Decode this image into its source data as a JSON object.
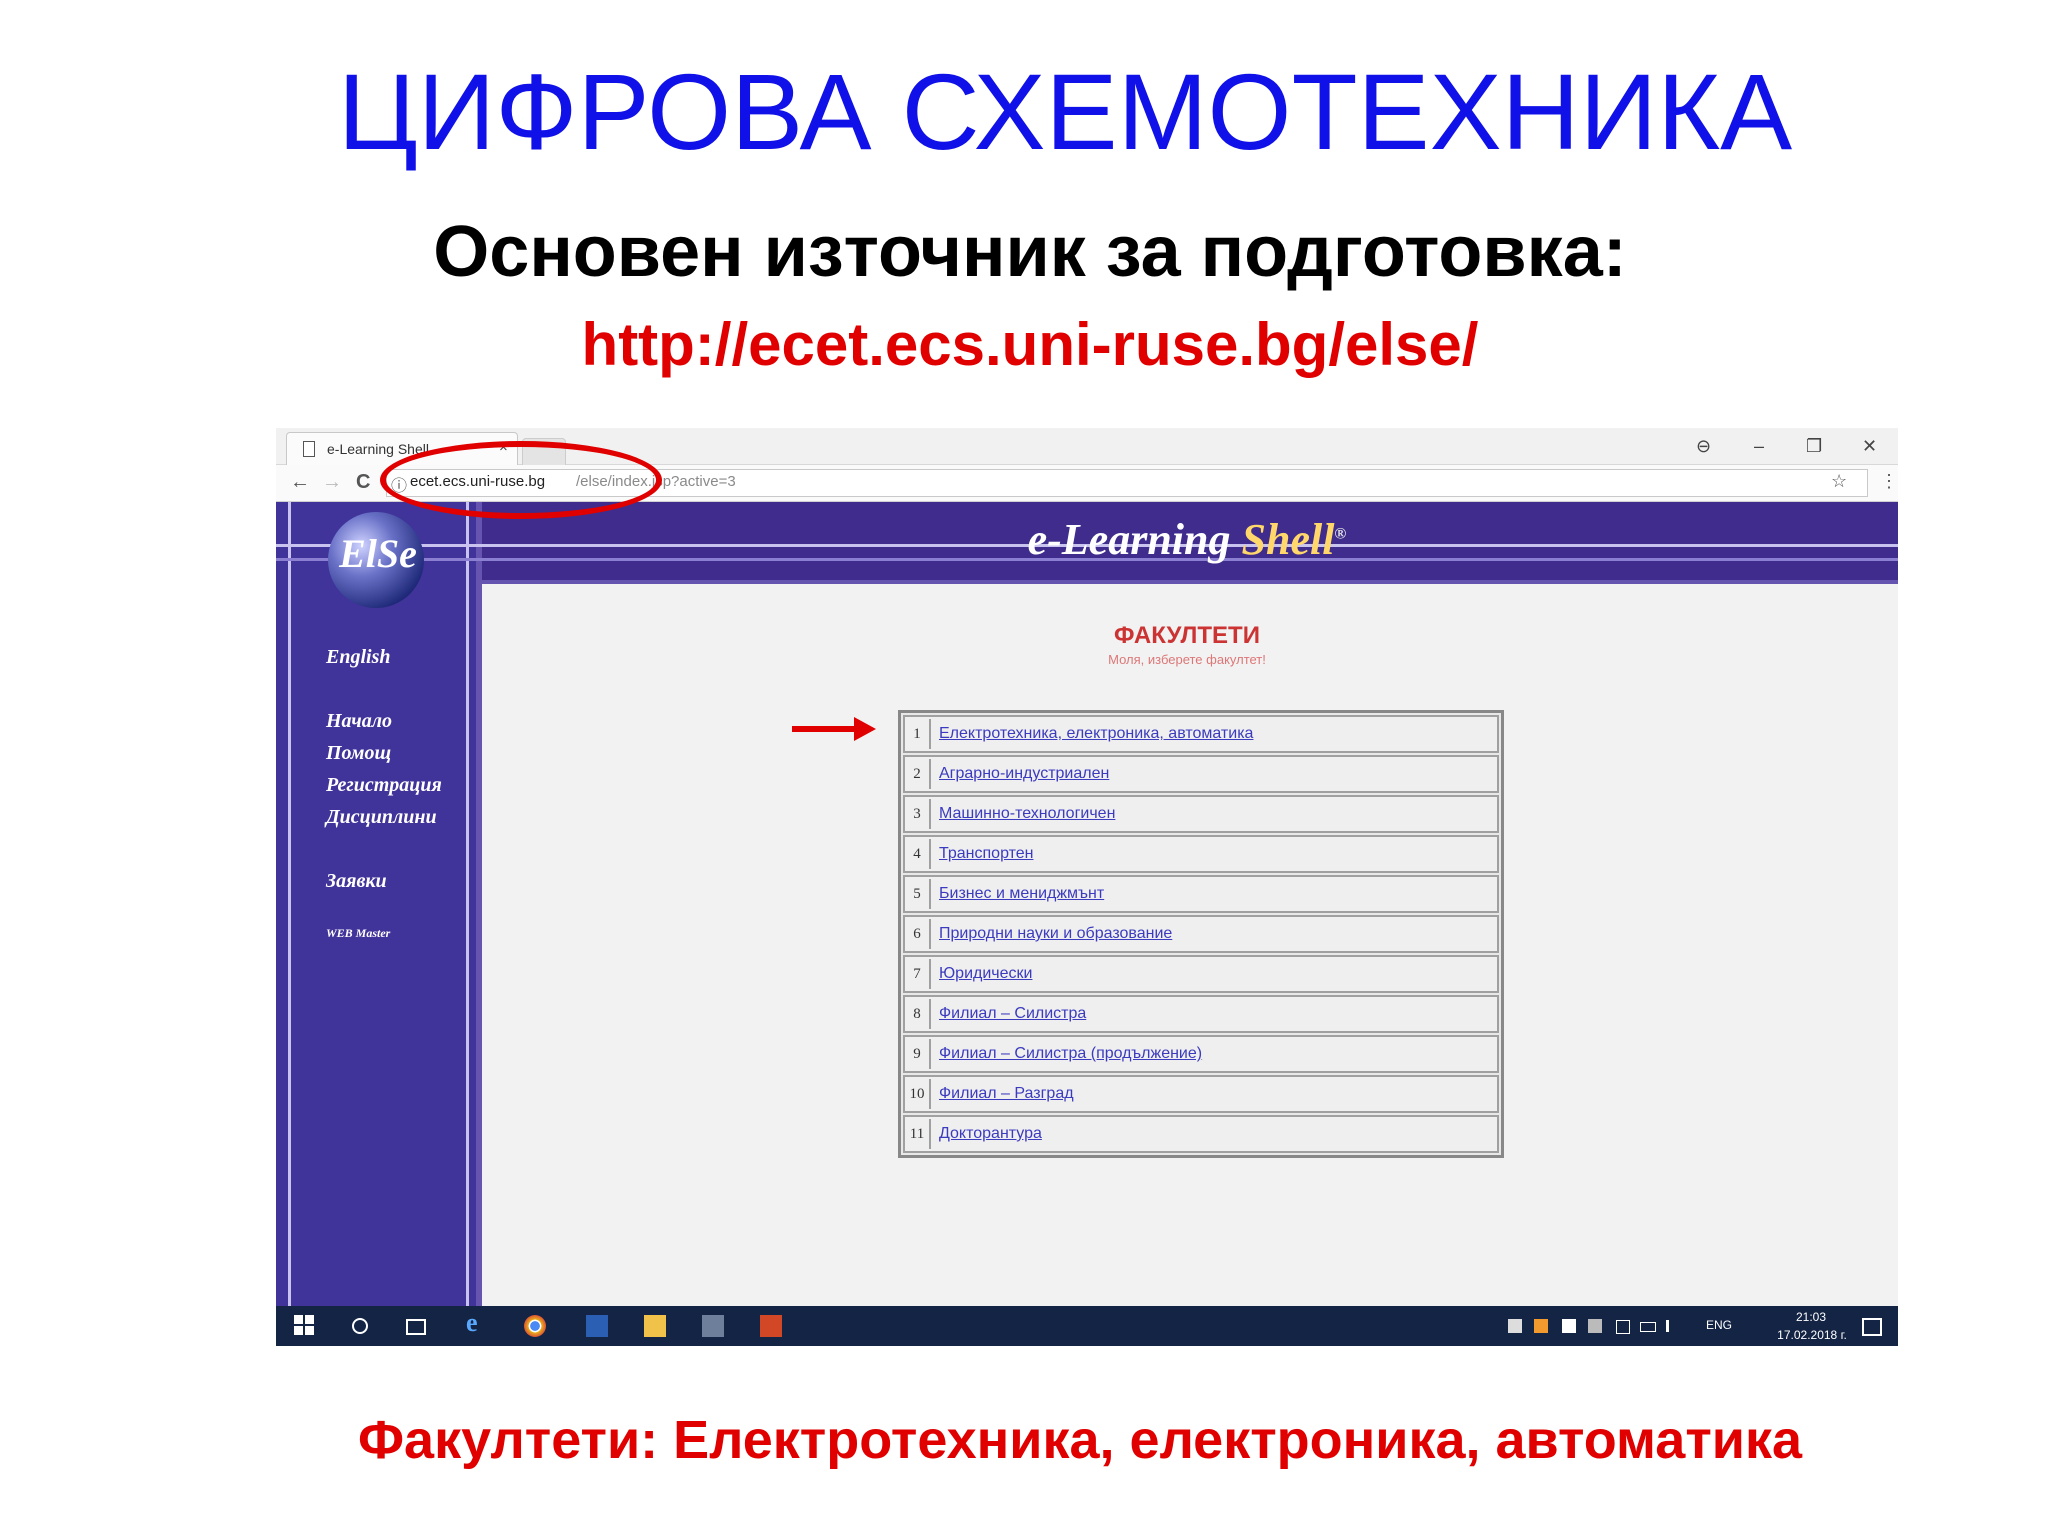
{
  "slide": {
    "title": "ЦИФРОВА СХЕМОТЕХНИКА",
    "subtitle": "Основен източник за подготовка:",
    "url": "http://ecet.ecs.uni-ruse.bg/else/",
    "caption": "Факултети: Електротехника, електроника, автоматика"
  },
  "browser": {
    "tab_title": "e-Learning Shell",
    "url_host": "ecet.ecs.uni-ruse.bg",
    "url_rest": "/else/index.jsp?active=3",
    "close_tab": "×",
    "back": "←",
    "forward": "→",
    "reload": "C",
    "info": "ⓘ",
    "star": "☆",
    "menu": "⋮",
    "account": "⊖",
    "minimize": "–",
    "restore": "❐",
    "close": "✕"
  },
  "site": {
    "logo_text": "ElSe",
    "brand_1": "e-Learning ",
    "brand_2": "Shell",
    "brand_mark": "®",
    "sidebar": {
      "english": "English",
      "home": "Начало",
      "help": "Помощ",
      "register": "Регистрация",
      "disciplines": "Дисциплини",
      "requests": "Заявки",
      "webmaster": "WEB Master"
    },
    "faculties_title": "ФАКУЛТЕТИ",
    "faculties_sub": "Моля, изберете факултет!",
    "faculties": [
      {
        "num": "1",
        "name": "Електротехника, електроника, автоматика"
      },
      {
        "num": "2",
        "name": "Аграрно-индустриален"
      },
      {
        "num": "3",
        "name": "Машинно-технологичен"
      },
      {
        "num": "4",
        "name": "Транспортен"
      },
      {
        "num": "5",
        "name": "Бизнес и мениджмънт"
      },
      {
        "num": "6",
        "name": "Природни науки и образование"
      },
      {
        "num": "7",
        "name": "Юридически"
      },
      {
        "num": "8",
        "name": "Филиал – Силистра"
      },
      {
        "num": "9",
        "name": "Филиал – Силистра (продължение)"
      },
      {
        "num": "10",
        "name": "Филиал – Разград"
      },
      {
        "num": "11",
        "name": "Докторантура"
      }
    ]
  },
  "taskbar": {
    "lang": "ENG",
    "time": "21:03",
    "date": "17.02.2018 г."
  },
  "colors": {
    "title_blue": "#1010e8",
    "accent_red": "#e00000",
    "site_purple": "#40339a",
    "taskbar": "#142445"
  }
}
